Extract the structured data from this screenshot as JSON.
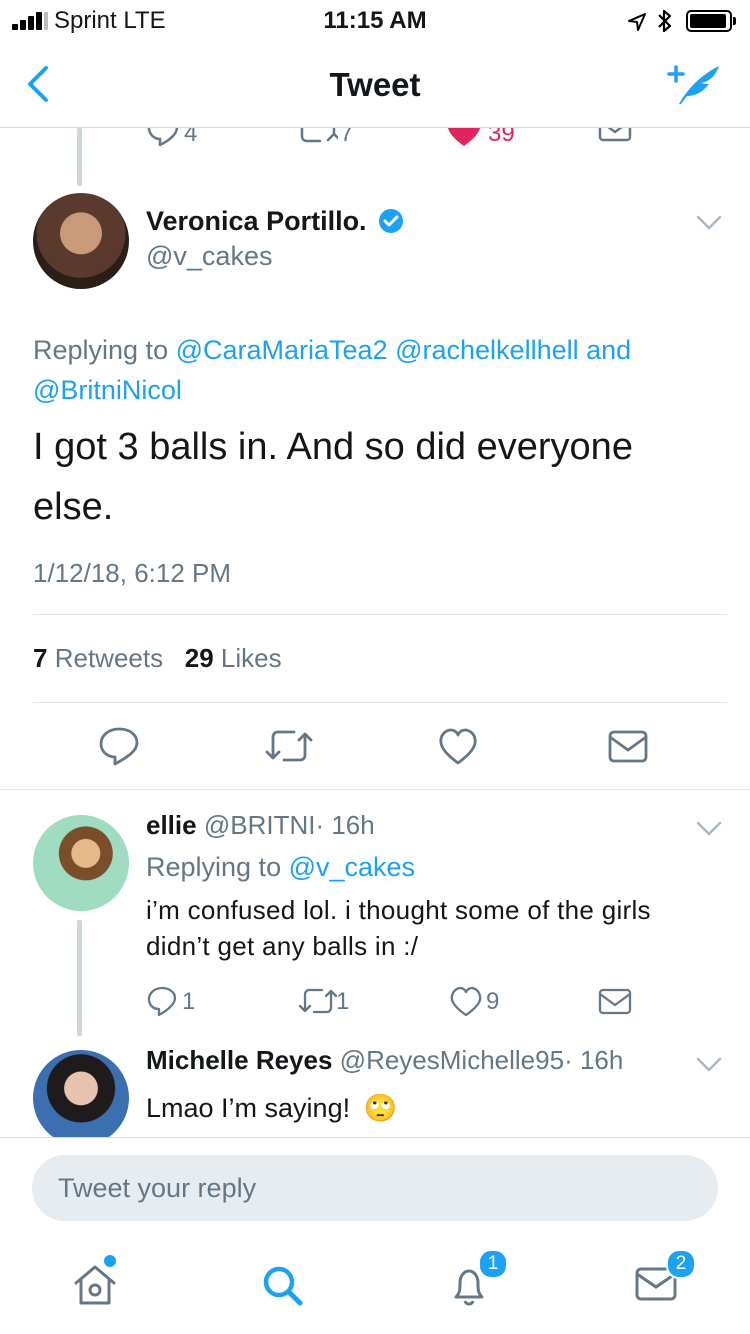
{
  "status_bar": {
    "carrier": "Sprint  LTE",
    "time": "11:15 AM"
  },
  "nav": {
    "title": "Tweet",
    "back_icon": "chevron-left-icon",
    "compose_icon": "compose-tweet-icon"
  },
  "prev_tweet_actions": {
    "reply_count": "4",
    "retweet_count": "7",
    "like_count": "39"
  },
  "main_tweet": {
    "name": "Veronica Portillo.",
    "verified": true,
    "handle": "@v_cakes",
    "replying_prefix": "Replying to ",
    "replying_to_1": "@CaraMariaTea2",
    "replying_to_2": "@rachelkellhell",
    "replying_and": "and",
    "replying_to_3": "@BritniNicol",
    "text_line1": "I got 3 balls in.  And so did everyone",
    "text_line2": "else.",
    "date": "1/12/18, 6:12 PM",
    "retweets_count": "7",
    "retweets_label": "Retweets",
    "likes_count": "29",
    "likes_label": "Likes"
  },
  "replies": [
    {
      "name": "ellie",
      "handle": "@BRITNI",
      "time": "· 16h",
      "replying_prefix": "Replying to ",
      "replying_to": "@v_cakes",
      "text_line1": "i’m confused lol. i thought some of the girls",
      "text_line2": "didn’t get any balls in :/",
      "reply_count": "1",
      "retweet_count": "1",
      "like_count": "9"
    },
    {
      "name": "Michelle Reyes",
      "handle": "@ReyesMichelle95",
      "time": "· 16h",
      "text": "Lmao I’m saying!",
      "emoji": "🙄"
    }
  ],
  "reply_box": {
    "placeholder": "Tweet your reply"
  },
  "tab_bar": {
    "notifications_badge": "1",
    "messages_badge": "2"
  },
  "colors": {
    "accent": "#1da1f2",
    "like": "#e0245e",
    "secondary_text": "#657786"
  }
}
